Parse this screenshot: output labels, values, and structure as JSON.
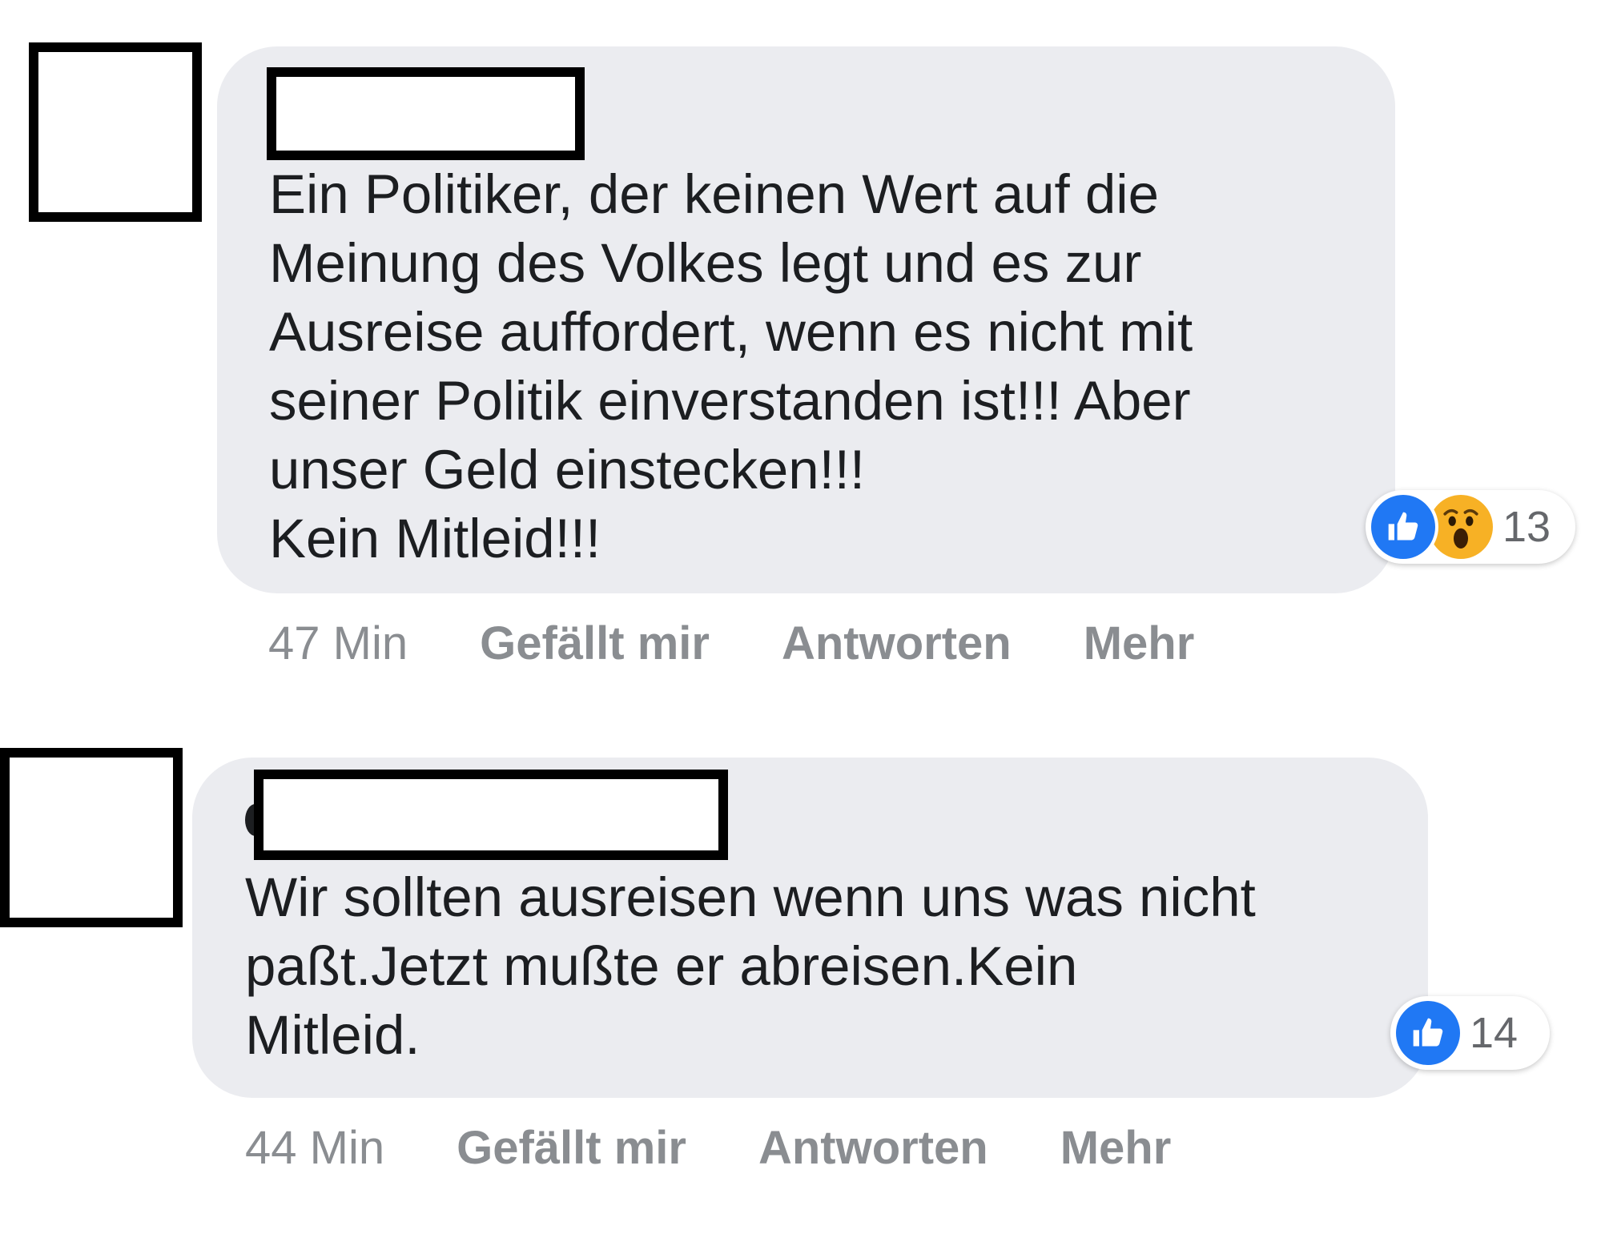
{
  "comments": [
    {
      "text": "Ein Politiker, der keinen Wert auf die\nMeinung des Volkes legt und es zur\nAusreise auffordert, wenn es nicht mit\nseiner Politik einverstanden ist!!! Aber\nunser Geld einstecken!!!\nKein Mitleid!!!",
      "reactions": {
        "types": [
          "like-icon",
          "wow-icon"
        ],
        "count": "13"
      },
      "actions": {
        "time": "47 Min",
        "like": "Gefällt mir",
        "reply": "Antworten",
        "more": "Mehr"
      }
    },
    {
      "text": "Wir sollten ausreisen wenn uns was nicht\npaßt.Jetzt mußte er abreisen.Kein\nMitleid.",
      "reactions": {
        "types": [
          "like-icon"
        ],
        "count": "14"
      },
      "actions": {
        "time": "44 Min",
        "like": "Gefällt mir",
        "reply": "Antworten",
        "more": "Mehr"
      }
    }
  ],
  "colors": {
    "bubble": "#ebecf0",
    "text": "#1c1e21",
    "meta": "#8a8d91",
    "like_blue": "#2078f4",
    "wow_yellow": "#f7b125",
    "redaction_border": "#000000"
  }
}
